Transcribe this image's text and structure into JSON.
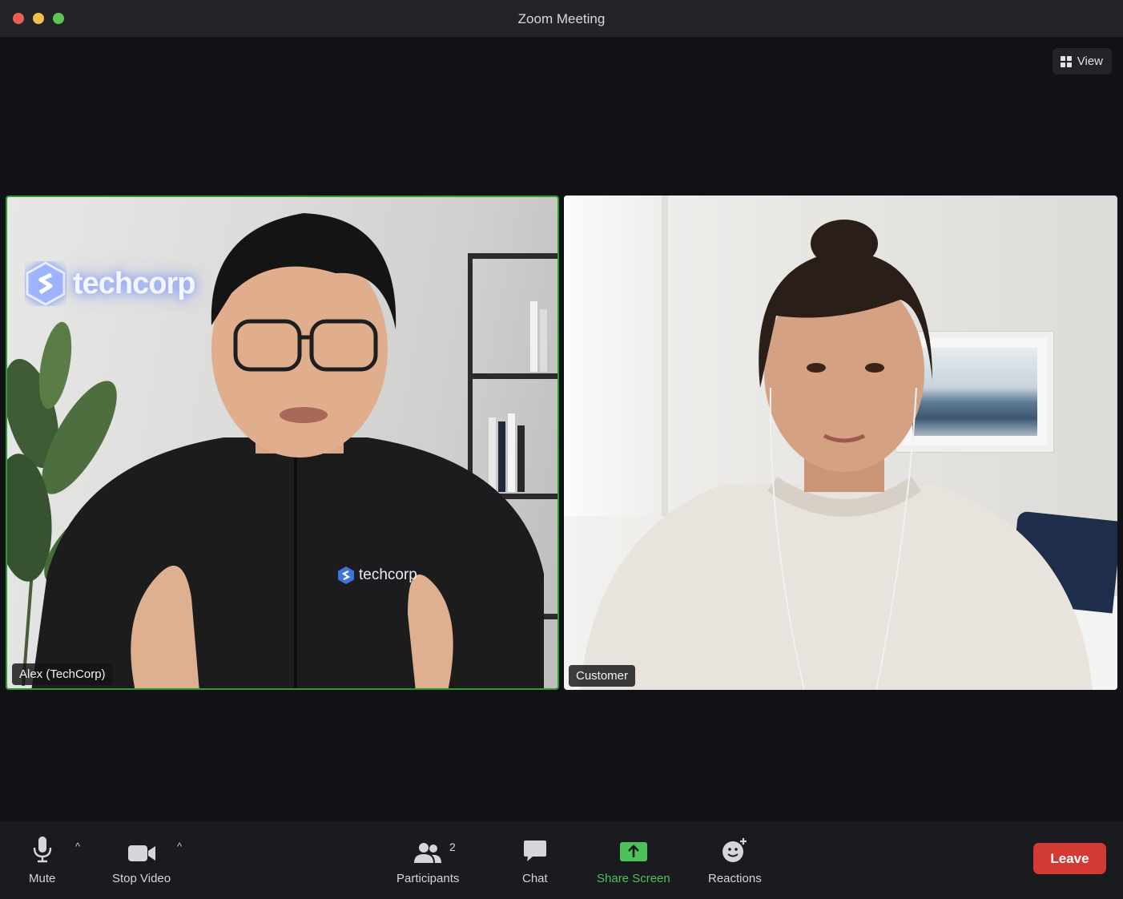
{
  "window": {
    "title": "Zoom Meeting"
  },
  "view_button": {
    "label": "View",
    "icon": "grid-icon"
  },
  "participants": [
    {
      "name": "Alex (TechCorp)",
      "active_speaker": true,
      "wall_logo_text": "techcorp",
      "shirt_logo_text": "techcorp"
    },
    {
      "name": "Customer",
      "active_speaker": false
    }
  ],
  "toolbar": {
    "mute": {
      "label": "Mute",
      "icon": "microphone-icon"
    },
    "video": {
      "label": "Stop Video",
      "icon": "video-camera-icon"
    },
    "participants": {
      "label": "Participants",
      "count": "2",
      "icon": "people-icon"
    },
    "chat": {
      "label": "Chat",
      "icon": "chat-bubble-icon"
    },
    "share": {
      "label": "Share Screen",
      "icon": "share-screen-icon"
    },
    "reactions": {
      "label": "Reactions",
      "icon": "smiley-plus-icon"
    },
    "leave": {
      "label": "Leave"
    }
  },
  "colors": {
    "active_speaker_border": "#2f9a35",
    "share_accent": "#4fc15a",
    "leave_button": "#d33a33",
    "background": "#111215"
  }
}
